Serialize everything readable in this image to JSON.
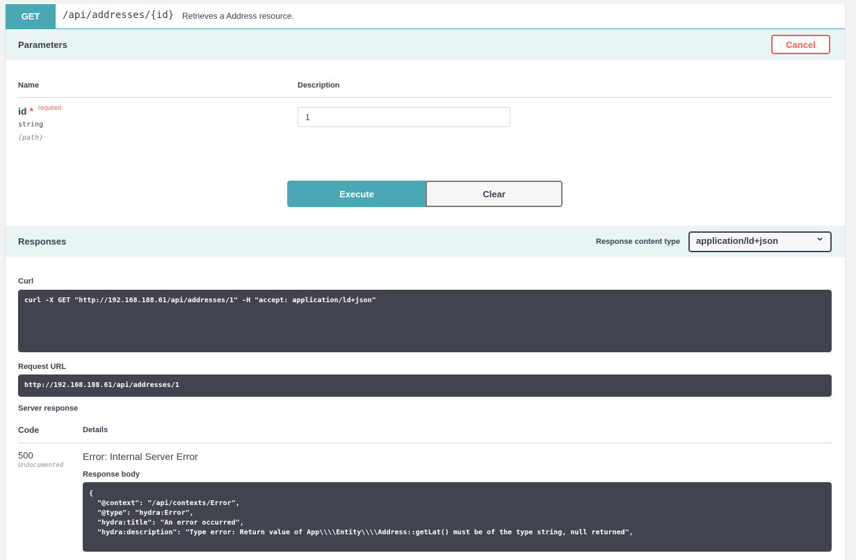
{
  "summary": {
    "method": "GET",
    "path": "/api/addresses/{id}",
    "description": "Retrieves a Address resource."
  },
  "parameters": {
    "title": "Parameters",
    "cancel_label": "Cancel",
    "col_name": "Name",
    "col_description": "Description",
    "param": {
      "name": "id",
      "star": "*",
      "required": "required",
      "type": "string",
      "in": "(path)",
      "value": "1"
    },
    "execute_label": "Execute",
    "clear_label": "Clear"
  },
  "responses": {
    "title": "Responses",
    "content_type_label": "Response content type",
    "content_type_value": "application/ld+json",
    "curl_label": "Curl",
    "curl": "curl -X GET \"http://192.168.188.61/api/addresses/1\" -H \"accept: application/ld+json\"",
    "request_url_label": "Request URL",
    "request_url": "http://192.168.188.61/api/addresses/1",
    "server_response_label": "Server response",
    "col_code": "Code",
    "col_details": "Details",
    "code": "500",
    "undocumented": "Undocumented",
    "error_title": "Error: Internal Server Error",
    "response_body_label": "Response body",
    "response_body": "{\n  \"@context\": \"/api/contexts/Error\",\n  \"@type\": \"hydra:Error\",\n  \"hydra:title\": \"An error occurred\",\n  \"hydra:description\": \"Type error: Return value of App\\\\\\\\Entity\\\\\\\\Address::getLat() must be of the type string, null returned\","
  },
  "colors": {
    "accent": "#49a8b3",
    "danger": "#f35a5a",
    "code_bg": "#41444e",
    "section_bg": "#e9f4f5"
  },
  "icons": {
    "select_chevron": "chevron-down-icon"
  }
}
